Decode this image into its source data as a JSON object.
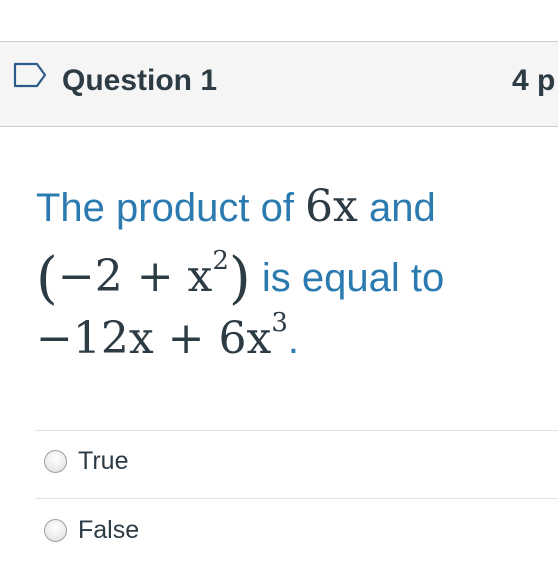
{
  "question": {
    "title": "Question 1",
    "points": "4 p",
    "flag_icon": "bookmark-flag-icon",
    "text": {
      "part1": "The product of ",
      "math1": "6x",
      "part2": " and",
      "math2_open": "(",
      "math2_inner": "−2 + x",
      "math2_exp": "2",
      "math2_close": ")",
      "part3": " is equal to",
      "math3": "−12x + 6x",
      "math3_exp": "3",
      "part4": "."
    }
  },
  "answers": [
    {
      "label": "True",
      "selected": false
    },
    {
      "label": "False",
      "selected": false
    }
  ],
  "colors": {
    "question_text": "#2b7ab0",
    "header_bg": "#f5f5f5",
    "title_text": "#2d3b45"
  }
}
